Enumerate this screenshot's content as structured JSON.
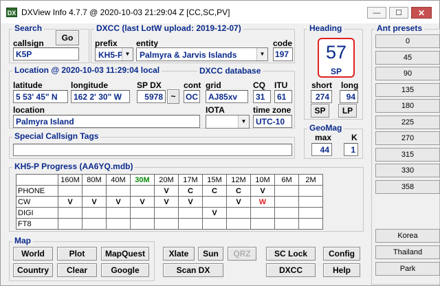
{
  "window": {
    "title": "DXView Info 4.7.7 @ 2020-10-03  21:29:04 Z  [CC,SC,PV]",
    "minimize_glyph": "—",
    "maximize_glyph": "☐",
    "close_glyph": "✕"
  },
  "search": {
    "group_label": "Search",
    "callsign_label": "callsign",
    "callsign_value": "K5P",
    "go_label": "Go"
  },
  "dxcc": {
    "group_label": "DXCC  (last LotW upload: 2019-12-07)",
    "prefix_label": "prefix",
    "prefix_value": "KH5-P",
    "entity_label": "entity",
    "entity_value": "Palmyra & Jarvis Islands",
    "code_label": "code",
    "code_value": "197"
  },
  "location": {
    "group_label": "Location @ 2020-10-03 11:29:04 local",
    "db_label": "DXCC database",
    "latitude_label": "latitude",
    "latitude_value": "5 53' 45\" N",
    "longitude_label": "longitude",
    "longitude_value": "162 2' 30\" W",
    "spdx_label": "SP DX",
    "spdx_value": "5978",
    "spdx_btn": "~",
    "cont_label": "cont",
    "cont_value": "OC",
    "grid_label": "grid",
    "grid_value": "AJ85xv",
    "cq_label": "CQ",
    "cq_value": "31",
    "itu_label": "ITU",
    "itu_value": "61",
    "location_label": "location",
    "location_value": "Palmyra Island",
    "iota_label": "IOTA",
    "iota_value": "",
    "tz_label": "time zone",
    "tz_value": "UTC-10"
  },
  "tags": {
    "group_label": "Special Callsign Tags",
    "value": ""
  },
  "heading": {
    "group_label": "Heading",
    "value": "57",
    "mode": "SP",
    "short_label": "short",
    "long_label": "long",
    "short_value": "274",
    "long_value": "94",
    "sp_btn": "SP",
    "lp_btn": "LP"
  },
  "geomag": {
    "group_label": "GeoMag",
    "max_label": "max",
    "k_label": "K",
    "max_value": "44",
    "k_value": "1"
  },
  "ant_presets": {
    "group_label": "Ant presets",
    "values": [
      "0",
      "45",
      "90",
      "135",
      "180",
      "225",
      "270",
      "315",
      "330",
      "358"
    ],
    "named": [
      "Korea",
      "Thailand",
      "Park"
    ]
  },
  "progress": {
    "group_label": "KH5-P Progress (AA6YQ.mdb)",
    "bands": [
      "160M",
      "80M",
      "40M",
      "30M",
      "20M",
      "17M",
      "15M",
      "12M",
      "10M",
      "6M",
      "2M"
    ],
    "highlight_band_color": "#0a8c0a",
    "worked_color": "#e02020",
    "rows": [
      {
        "mode": "PHONE",
        "cells": [
          "",
          "",
          "",
          "",
          "V",
          "C",
          "C",
          "C",
          "V",
          "",
          ""
        ]
      },
      {
        "mode": "CW",
        "cells": [
          "V",
          "V",
          "V",
          "V",
          "V",
          "V",
          "",
          "V",
          "W",
          "",
          ""
        ]
      },
      {
        "mode": "DIGI",
        "cells": [
          "",
          "",
          "",
          "",
          "",
          "",
          "V",
          "",
          "",
          "",
          ""
        ]
      },
      {
        "mode": "FT8",
        "cells": [
          "",
          "",
          "",
          "",
          "",
          "",
          "",
          "",
          "",
          "",
          ""
        ]
      }
    ]
  },
  "map": {
    "group_label": "Map",
    "world": "World",
    "plot": "Plot",
    "mapquest": "MapQuest",
    "country": "Country",
    "clear": "Clear",
    "google": "Google"
  },
  "actions": {
    "xlate": "Xlate",
    "sun": "Sun",
    "qrz": "QRZ",
    "sclock": "SC Lock",
    "config": "Config",
    "scandx": "Scan DX",
    "dxcc": "DXCC",
    "help": "Help"
  }
}
